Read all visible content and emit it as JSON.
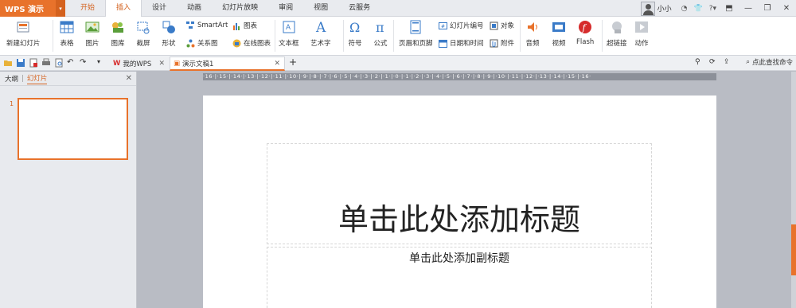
{
  "app": {
    "name": "WPS 演示",
    "menu_arrow": "▾"
  },
  "menu_tabs": [
    "开始",
    "插入",
    "设计",
    "动画",
    "幻灯片放映",
    "审阅",
    "视图",
    "云服务"
  ],
  "user": {
    "name": "小小"
  },
  "window_controls": [
    "⬒",
    "—",
    "❐",
    "✕"
  ],
  "ribbon": {
    "new_slide": "新建幻灯片",
    "table": "表格",
    "picture": "图片",
    "gallery": "图库",
    "screenshot": "截屏",
    "shape": "形状",
    "smartart": "SmartArt",
    "chart": "图表",
    "relation": "关系图",
    "online_chart": "在线图表",
    "textbox": "文本框",
    "wordart": "艺术字",
    "symbol": "符号",
    "formula": "公式",
    "header_footer": "页眉和页脚",
    "slide_number": "幻灯片编号",
    "object": "对象",
    "datetime": "日期和时间",
    "attachment": "附件",
    "audio": "音频",
    "video": "视频",
    "flash": "Flash",
    "hyperlink": "超链接",
    "action": "动作"
  },
  "tabs": {
    "home": "我的WPS",
    "doc": "演示文稿1",
    "find": "点此查找命令"
  },
  "left_panel": {
    "outline": "大纲",
    "slides": "幻灯片",
    "slide_num": "1"
  },
  "ruler": "·16·|·15·|·14·|·13·|·12·|·11·|·10·|·9·|·8·|·7·|·6·|·5·|·4·|·3·|·2·|·1·|·0·|·1·|·2·|·3·|·4·|·5·|·6·|·7·|·8·|·9·|·10·|·11·|·12·|·13·|·14·|·15·|·16·",
  "slide": {
    "title_placeholder": "单击此处添加标题",
    "subtitle_placeholder": "单击此处添加副标题"
  },
  "colors": {
    "accent": "#e8722b"
  }
}
